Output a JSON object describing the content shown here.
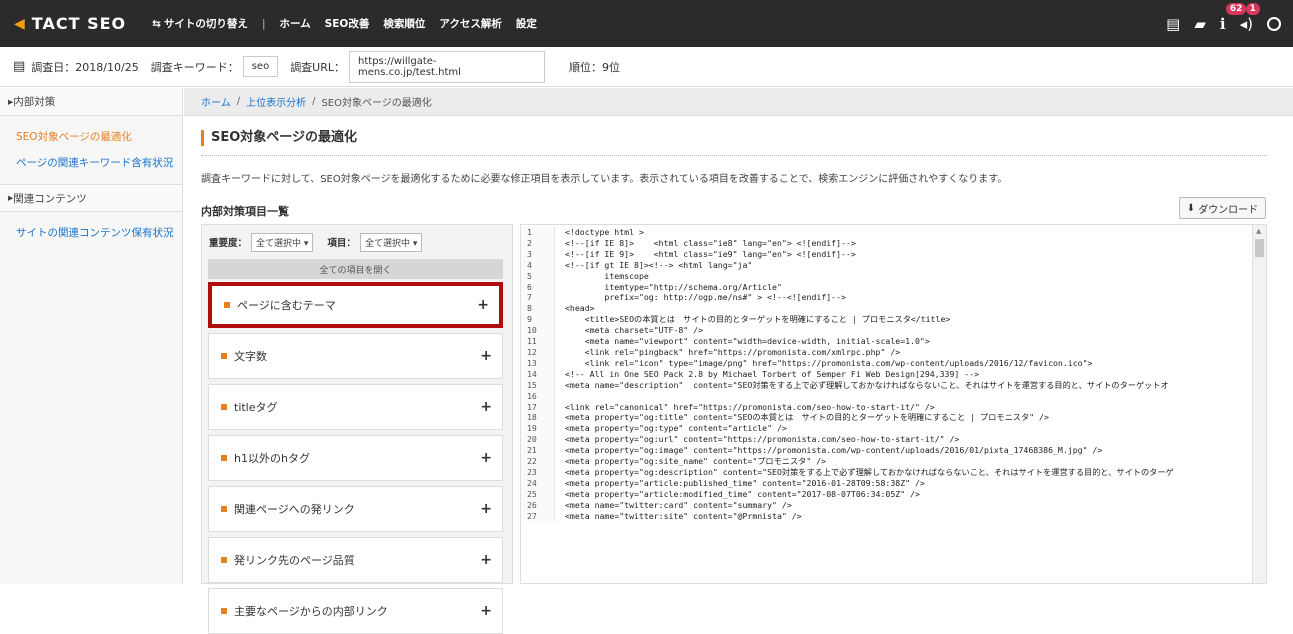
{
  "topbar": {
    "logo": "TACT SEO",
    "nav": [
      "サイトの切り替え",
      "ホーム",
      "SEO改善",
      "検索順位",
      "アクセス解析",
      "設定"
    ],
    "notification_count": "62",
    "alert_count": "1"
  },
  "infobar": {
    "survey_date": "調査日：2018/10/25",
    "keyword_label": "調査キーワード：",
    "keyword_value": "seo",
    "url_label": "調査URL：",
    "url_value": "https://willgate-mens.co.jp/test.html",
    "rank": "順位：9位"
  },
  "sidebar": {
    "section1": "内部対策",
    "links1": [
      "SEO対象ページの最適化",
      "ページの関連キーワード含有状況"
    ],
    "section2": "関連コンテンツ",
    "links2": [
      "サイトの関連コンテンツ保有状況"
    ]
  },
  "breadcrumb": [
    "ホーム",
    "上位表示分析",
    "SEO対象ページの最適化"
  ],
  "main": {
    "title": "SEO対象ページの最適化",
    "description": "調査キーワードに対して、SEO対象ページを最適化するために必要な修正項目を表示しています。表示されている項目を改善することで、検索エンジンに評価されやすくなります。",
    "section_title": "内部対策項目一覧",
    "download_label": "ダウンロード"
  },
  "filters": {
    "importance_label": "重要度：",
    "importance_value": "全て選択中",
    "item_label": "項目：",
    "item_value": "全て選択中",
    "open_all": "全ての項目を開く"
  },
  "items": [
    "ページに含むテーマ",
    "文字数",
    "titleタグ",
    "h1以外のhタグ",
    "関連ページへの発リンク",
    "発リンク先のページ品質",
    "主要なページからの内部リンク"
  ],
  "code": [
    "<!doctype html >",
    "<!--[if IE 8]>    <html class=\"ie8\" lang=\"en\"> <![endif]-->",
    "<!--[if IE 9]>    <html class=\"ie9\" lang=\"en\"> <![endif]-->",
    "<!--[if gt IE 8]><!--> <html lang=\"ja\"",
    "        itemscope",
    "        itemtype=\"http://schema.org/Article\"",
    "        prefix=\"og: http://ogp.me/ns#\" > <!--<![endif]-->",
    "<head>",
    "    <title>SEOの本質とは　サイトの目的とターゲットを明確にすること | プロモニスタ</title>",
    "    <meta charset=\"UTF-8\" />",
    "    <meta name=\"viewport\" content=\"width=device-width, initial-scale=1.0\">",
    "    <link rel=\"pingback\" href=\"https://promonista.com/xmlrpc.php\" />",
    "    <link rel=\"icon\" type=\"image/png\" href=\"https://promonista.com/wp-content/uploads/2016/12/favicon.ico\">",
    "<!-- All in One SEO Pack 2.8 by Michael Torbert of Semper Fi Web Design[294,339] -->",
    "<meta name=\"description\"  content=\"SEO対策をする上で必ず理解しておかなければならないこと、それはサイトを運営する目的と、サイトのターゲットオ",
    "",
    "<link rel=\"canonical\" href=\"https://promonista.com/seo-how-to-start-it/\" />",
    "<meta property=\"og:title\" content=\"SEOの本質とは　サイトの目的とターゲットを明確にすること | プロモニスタ\" />",
    "<meta property=\"og:type\" content=\"article\" />",
    "<meta property=\"og:url\" content=\"https://promonista.com/seo-how-to-start-it/\" />",
    "<meta property=\"og:image\" content=\"https://promonista.com/wp-content/uploads/2016/01/pixta_17468386_M.jpg\" />",
    "<meta property=\"og:site_name\" content=\"プロモニスタ\" />",
    "<meta property=\"og:description\" content=\"SEO対策をする上で必ず理解しておかなければならないこと、それはサイトを運営する目的と、サイトのターゲ",
    "<meta property=\"article:published_time\" content=\"2016-01-28T09:58:38Z\" />",
    "<meta property=\"article:modified_time\" content=\"2017-08-07T06:34:05Z\" />",
    "<meta name=\"twitter:card\" content=\"summary\" />",
    "<meta name=\"twitter:site\" content=\"@Prmnista\" />"
  ]
}
